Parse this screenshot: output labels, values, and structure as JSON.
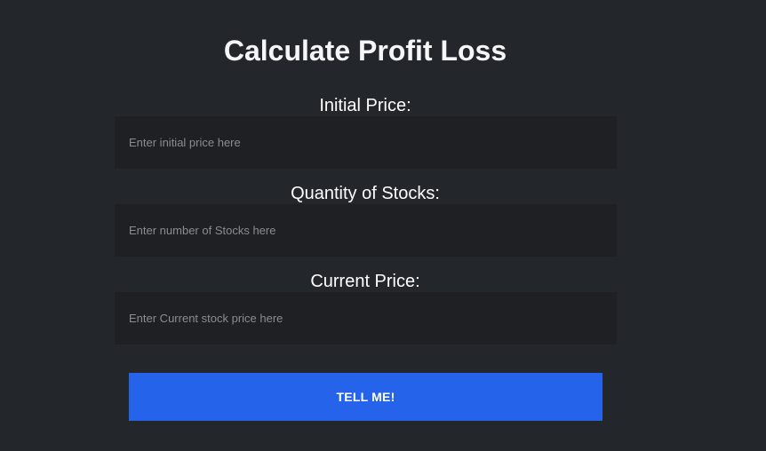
{
  "page": {
    "title": "Calculate Profit Loss"
  },
  "form": {
    "initial_price": {
      "label": "Initial Price:",
      "placeholder": "Enter initial price here",
      "value": ""
    },
    "quantity": {
      "label": "Quantity of Stocks:",
      "placeholder": "Enter number of Stocks here",
      "value": ""
    },
    "current_price": {
      "label": "Current Price:",
      "placeholder": "Enter Current stock price here",
      "value": ""
    },
    "submit_label": "TELL ME!"
  },
  "colors": {
    "background": "#23262b",
    "input_background": "#1f2024",
    "button_accent": "#2563eb"
  }
}
